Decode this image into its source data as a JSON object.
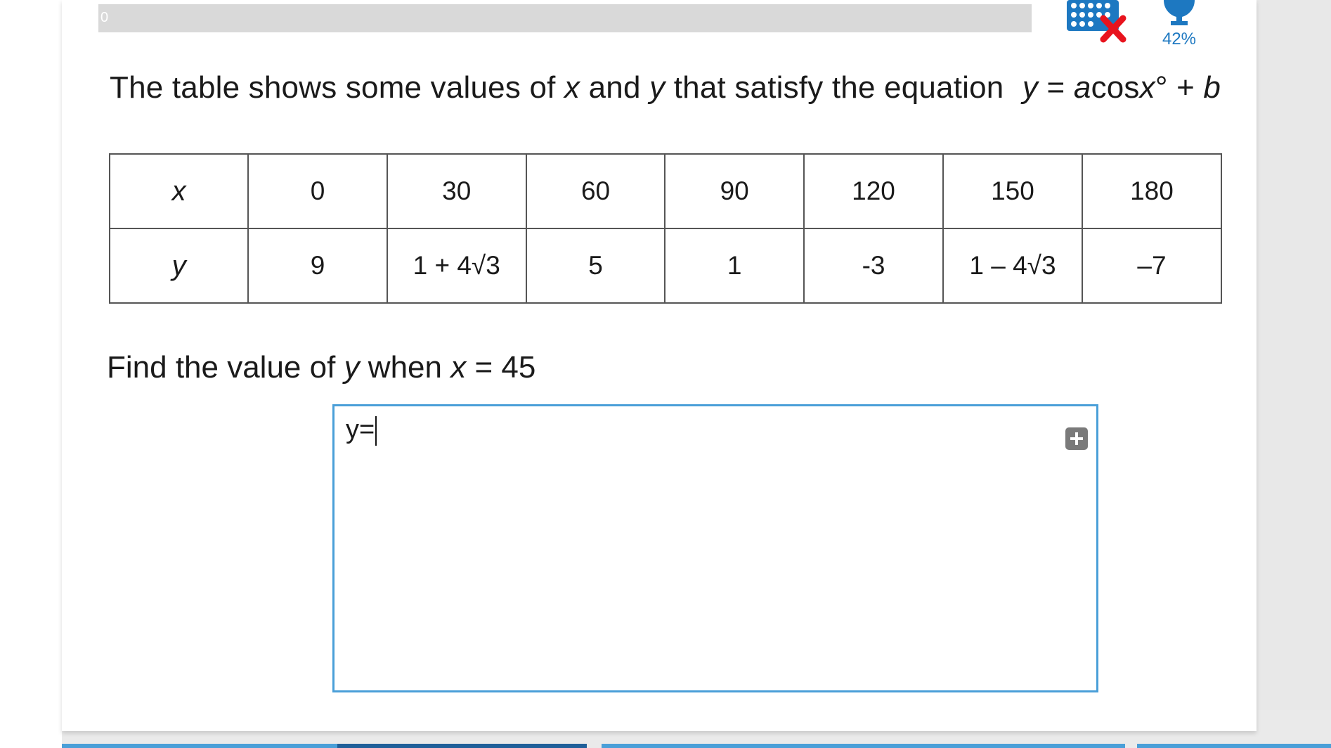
{
  "progress": {
    "label": "0",
    "value": 0
  },
  "header": {
    "grid_icon": "calculator-not-allowed-icon",
    "trophy_icon": "trophy-icon",
    "score_percent": "42%",
    "accent_color": "#1d78c1",
    "cross_color": "#e8131d"
  },
  "question": {
    "text": "The table shows some values of",
    "var_x": "x",
    "and": "and",
    "var_y": "y",
    "text2": "that satisfy the equation",
    "eq_y": "y",
    "eq_equals": "=",
    "eq_a": "a",
    "eq_cos": "cos",
    "eq_x": "x",
    "eq_deg": "°",
    "eq_plus": "+",
    "eq_b": "b"
  },
  "table": {
    "row_x": {
      "label": "x",
      "values": [
        "0",
        "30",
        "60",
        "90",
        "120",
        "150",
        "180"
      ]
    },
    "row_y": {
      "label": "y",
      "values": [
        "9",
        "1 + 4√3",
        "5",
        "1",
        "-3",
        "1 – 4√3",
        "–7"
      ]
    }
  },
  "find": {
    "prefix": "Find the value of",
    "var_y": "y",
    "when": "when",
    "var_x": "x",
    "rest": "= 45"
  },
  "answer": {
    "value": "y=",
    "insert_icon": "plus-square-icon",
    "border_color": "#4a9fd8"
  }
}
